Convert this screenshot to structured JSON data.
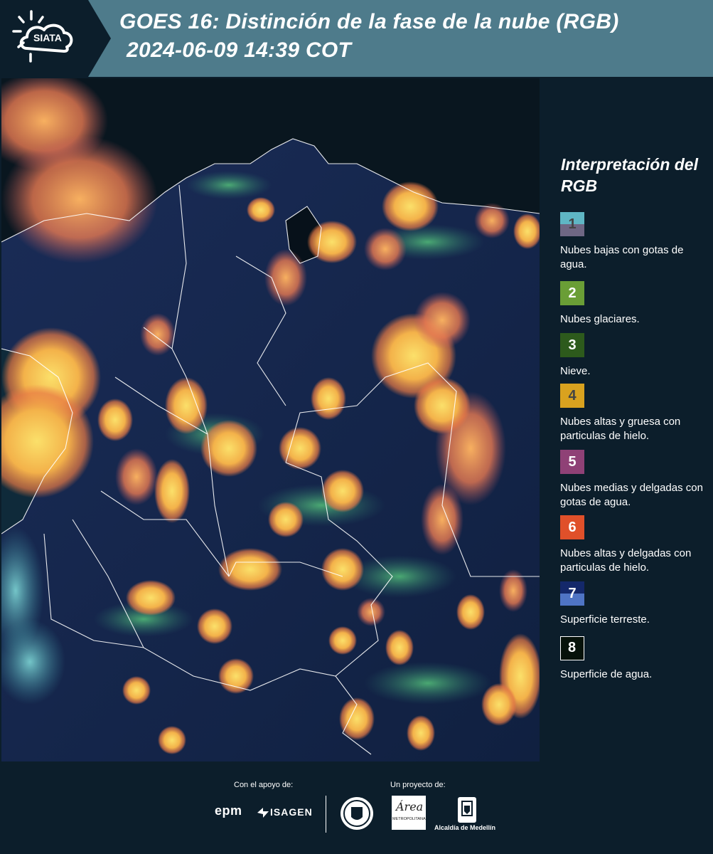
{
  "header": {
    "logo_text": "SIATA",
    "title_line1": "GOES 16: Distinción de la fase de la nube (RGB)",
    "title_line2": "2024-06-09 14:39 COT"
  },
  "legend": {
    "title": "Interpretación del RGB",
    "items": [
      {
        "num": "1",
        "label": "Nubes bajas con gotas de agua.",
        "color_top": "#5fb6c4",
        "color_bottom": "#6f6784",
        "num_color": "#444444"
      },
      {
        "num": "2",
        "label": "Nubes glaciares.",
        "color_top": "#6a9e36",
        "color_bottom": "#6a9e36",
        "num_color": "#ffffff"
      },
      {
        "num": "3",
        "label": "Nieve.",
        "color_top": "#2d5a1c",
        "color_bottom": "#2d5a1c",
        "num_color": "#ffffff"
      },
      {
        "num": "4",
        "label": "Nubes altas y gruesa con particulas de hielo.",
        "color_top": "#d9a21f",
        "color_bottom": "#d9a21f",
        "num_color": "#444444"
      },
      {
        "num": "5",
        "label": "Nubes medias y delgadas con gotas de agua.",
        "color_top": "#8f4176",
        "color_bottom": "#8f4176",
        "num_color": "#ffffff"
      },
      {
        "num": "6",
        "label": "Nubes altas y delgadas con particulas de hielo.",
        "color_top": "#e0502a",
        "color_bottom": "#e0502a",
        "num_color": "#ffffff"
      },
      {
        "num": "7",
        "label": "Superficie terreste.",
        "color_top": "#14286a",
        "color_bottom": "#4f74c4",
        "num_color": "#ffffff"
      },
      {
        "num": "8",
        "label": "Superficie de agua.",
        "color_top": "#07120a",
        "color_bottom": "#07120a",
        "num_color": "#ffffff"
      }
    ]
  },
  "footer": {
    "support_label": "Con el apoyo de:",
    "project_label": "Un proyecto de:",
    "epm": "epm",
    "isagen": "ISAGEN",
    "area_text": "Área",
    "metropolitana_text": "METROPOLITANA",
    "alcaldia": "Alcaldía de Medellín"
  },
  "colors": {
    "header_bg": "#4e7b8b",
    "logo_bg": "#0c1e2b",
    "panel_bg": "#0c1e2b",
    "cloud_yellow": "#f2c24a",
    "cloud_orange": "#f08a4a",
    "cloud_green": "#3fa86a",
    "land": "#13224a"
  }
}
